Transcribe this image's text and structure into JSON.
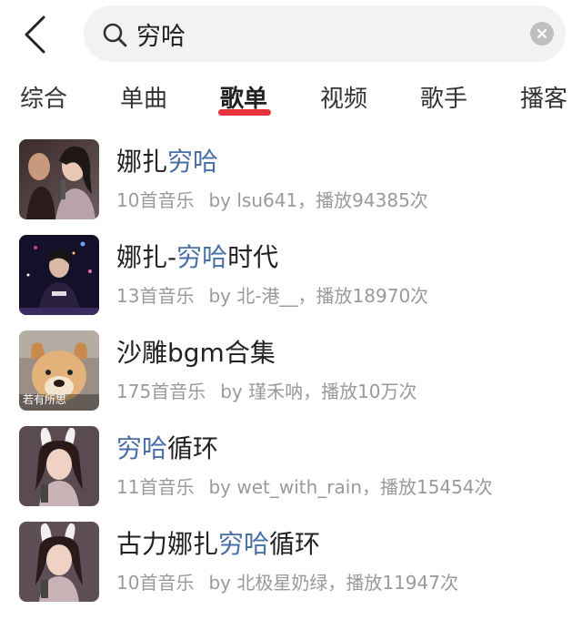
{
  "search": {
    "query": "穷哈"
  },
  "tabs": [
    {
      "label": "综合",
      "active": false
    },
    {
      "label": "单曲",
      "active": false
    },
    {
      "label": "歌单",
      "active": true
    },
    {
      "label": "视频",
      "active": false
    },
    {
      "label": "歌手",
      "active": false
    },
    {
      "label": "播客",
      "active": false
    }
  ],
  "playlists": [
    {
      "title_pre": "娜扎",
      "title_hl": "穷哈",
      "title_post": "",
      "count": "10首音乐",
      "creator": "by lsu641，播放94385次",
      "cover_caption": ""
    },
    {
      "title_pre": "娜扎-",
      "title_hl": "穷哈",
      "title_post": "时代",
      "count": "13首音乐",
      "creator": "by 北-港__，播放18970次",
      "cover_caption": ""
    },
    {
      "title_pre": "沙雕bgm合集",
      "title_hl": "",
      "title_post": "",
      "count": "175首音乐",
      "creator": "by 瑾禾呐，播放10万次",
      "cover_caption": "若有所思"
    },
    {
      "title_pre": "",
      "title_hl": "穷哈",
      "title_post": "循环",
      "count": "11首音乐",
      "creator": "by wet_with_rain，播放15454次",
      "cover_caption": ""
    },
    {
      "title_pre": "古力娜扎",
      "title_hl": "穷哈",
      "title_post": "循环",
      "count": "10首音乐",
      "creator": "by 北极星奶绿，播放11947次",
      "cover_caption": ""
    }
  ],
  "colors": {
    "accent_red": "#e8333c",
    "highlight_blue": "#4a6fa5",
    "meta_gray": "#9a9a9a"
  }
}
